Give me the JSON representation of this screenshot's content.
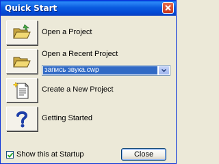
{
  "window": {
    "title": "Quick Start"
  },
  "items": [
    {
      "label": "Open a Project",
      "icon": "open-folder-icon"
    },
    {
      "label": "Open a Recent Project",
      "icon": "open-folder-icon"
    },
    {
      "label": "Create a New Project",
      "icon": "new-document-icon"
    },
    {
      "label": "Getting Started",
      "icon": "help-question-icon"
    }
  ],
  "recent_project": {
    "selected": "запись звука.cwp"
  },
  "footer": {
    "show_at_startup_label": "Show this at Startup",
    "show_at_startup_checked": true,
    "close_label": "Close"
  },
  "colors": {
    "titlebar": "#0a5fe6",
    "dialog_bg": "#ece9d8",
    "selection": "#316ac5"
  }
}
